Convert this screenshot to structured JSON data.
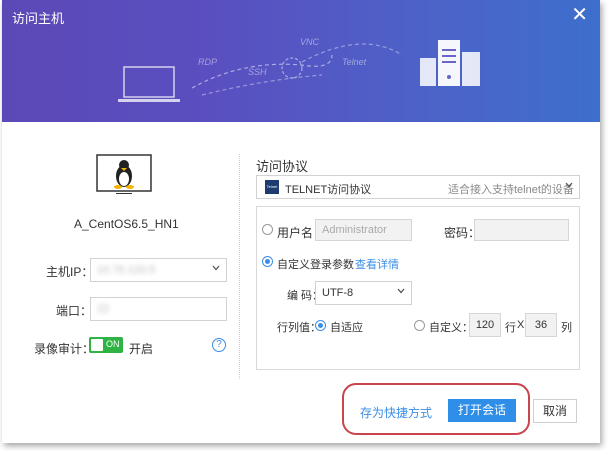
{
  "dialog": {
    "title": "访问主机",
    "close_glyph": "✕"
  },
  "header_art": {
    "labels": [
      "RDP",
      "SSH",
      "VNC",
      "Telnet"
    ],
    "icons": [
      "laptop-icon",
      "server-rack-icon"
    ]
  },
  "host": {
    "name": "A_CentOS6.5_HN1",
    "icon": "linux-monitor-icon"
  },
  "form": {
    "ip_label": "主机IP：",
    "ip_value": "10.76.120.5",
    "port_label": "端口：",
    "port_value": "22",
    "record_label": "录像审计：",
    "record_toggle": "ON",
    "record_state": "开启"
  },
  "protocol": {
    "section_label": "访问协议",
    "selected": "TELNET访问协议",
    "description": "适合接入支持telnet的设备",
    "icon_text": "Telnet"
  },
  "login": {
    "username_label": "用户名：",
    "username_placeholder": "Administrator",
    "password_label": "密码：",
    "custom_label": "自定义登录参数",
    "details_link": "查看详情"
  },
  "encoding": {
    "label": "编 码：",
    "value": "UTF-8"
  },
  "rowcol": {
    "label": "行列值：",
    "auto_label": "自适应",
    "custom_label": "自定义：",
    "rows": "120",
    "row_unit": "行",
    "times": "X",
    "cols": "36",
    "col_unit": "列"
  },
  "buttons": {
    "shortcut": "存为快捷方式",
    "open": "打开会话",
    "cancel": "取消"
  },
  "colors": {
    "header_start": "#5b49b6",
    "header_end": "#3d6fcd",
    "primary": "#2f8fe8",
    "toggle_on": "#2fb344",
    "highlight": "#c9444b"
  }
}
